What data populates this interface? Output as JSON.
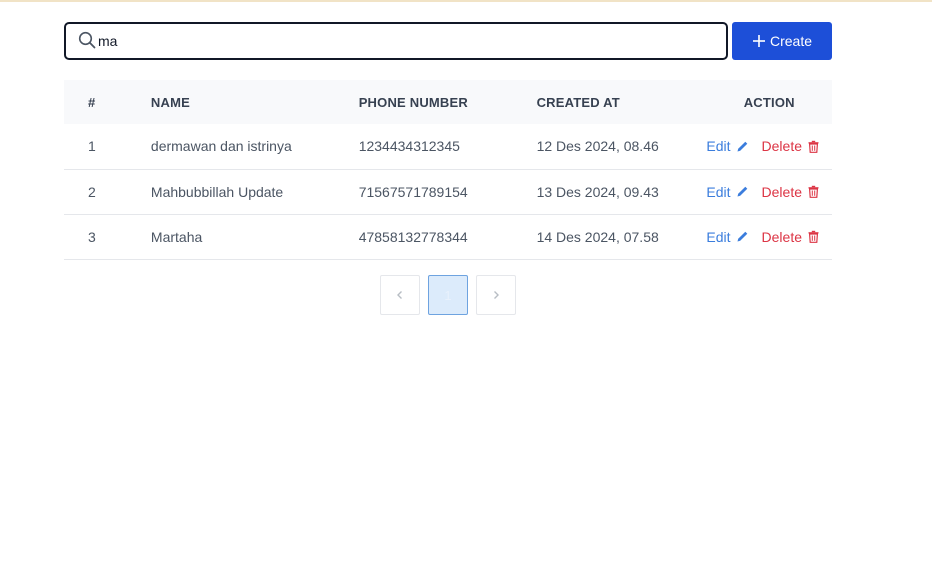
{
  "search": {
    "value": "ma",
    "placeholder": ""
  },
  "create_button": {
    "label": "Create"
  },
  "table": {
    "headers": [
      "#",
      "NAME",
      "PHONE NUMBER",
      "CREATED AT",
      "ACTION"
    ],
    "rows": [
      {
        "num": "1",
        "name": "dermawan dan istrinya",
        "phone": "1234434312345",
        "created": "12 Des 2024, 08.46"
      },
      {
        "num": "2",
        "name": "Mahbubbillah Update",
        "phone": "71567571789154",
        "created": "13 Des 2024, 09.43"
      },
      {
        "num": "3",
        "name": "Martaha",
        "phone": "47858132778344",
        "created": "14 Des 2024, 07.58"
      }
    ],
    "edit_label": "Edit",
    "delete_label": "Delete"
  },
  "pagination": {
    "current_page": "1"
  },
  "colors": {
    "primary": "#1d4fd8",
    "edit": "#3b7ddd",
    "delete": "#dc3545"
  },
  "icons": [
    "search-icon",
    "plus-icon",
    "pencil-icon",
    "trash-icon",
    "chevron-left-icon",
    "chevron-right-icon"
  ]
}
